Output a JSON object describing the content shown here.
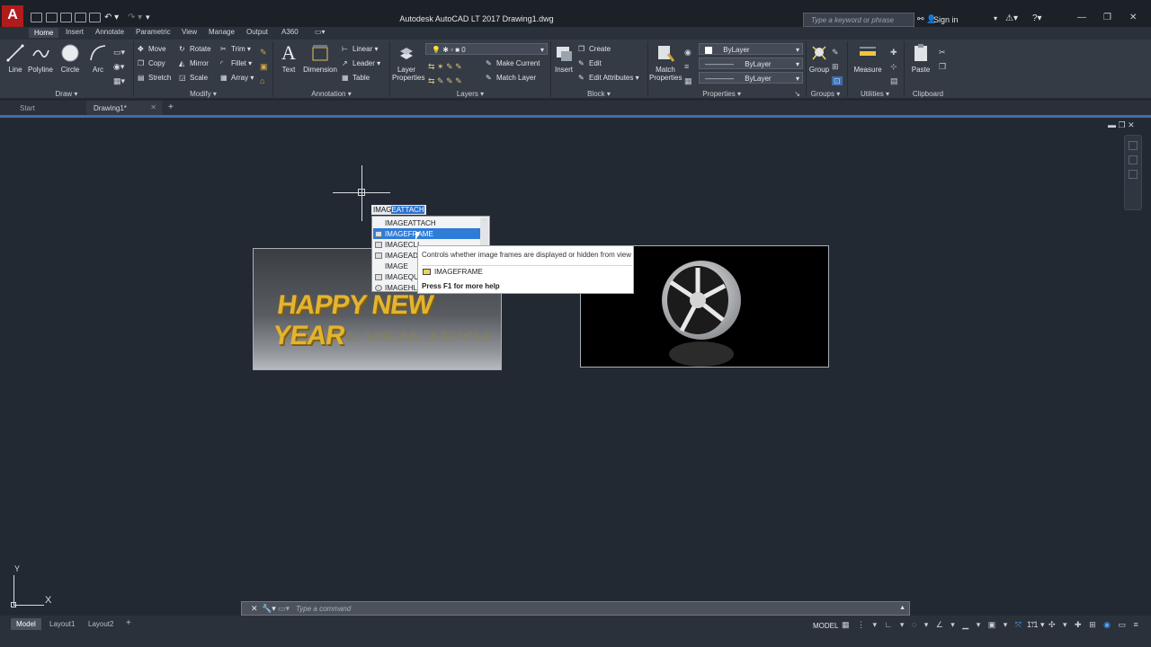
{
  "app": {
    "title": "Autodesk AutoCAD LT 2017   Drawing1.dwg",
    "logo_letter": "A",
    "search_placeholder": "Type a keyword or phrase",
    "signin": "Sign in"
  },
  "ribbon_tabs": [
    "Home",
    "Insert",
    "Annotate",
    "Parametric",
    "View",
    "Manage",
    "Output",
    "A360"
  ],
  "draw": {
    "line": "Line",
    "polyline": "Polyline",
    "circle": "Circle",
    "arc": "Arc",
    "panel": "Draw"
  },
  "modify": {
    "move": "Move",
    "rotate": "Rotate",
    "trim": "Trim",
    "copy": "Copy",
    "mirror": "Mirror",
    "fillet": "Fillet",
    "stretch": "Stretch",
    "scale": "Scale",
    "array": "Array",
    "panel": "Modify"
  },
  "annotation": {
    "text": "Text",
    "dimension": "Dimension",
    "linear": "Linear",
    "leader": "Leader",
    "table": "Table",
    "panel": "Annotation"
  },
  "layers": {
    "layer_properties": "Layer Properties",
    "current_layer": "0",
    "make_current": "Make Current",
    "match_layer": "Match Layer",
    "panel": "Layers"
  },
  "block": {
    "insert": "Insert",
    "create": "Create",
    "edit": "Edit",
    "edit_attributes": "Edit Attributes",
    "panel": "Block"
  },
  "properties": {
    "match_properties": "Match Properties",
    "color": "ByLayer",
    "linetype": "ByLayer",
    "lineweight": "ByLayer",
    "panel": "Properties"
  },
  "groups": {
    "group": "Group",
    "panel": "Groups"
  },
  "utilities": {
    "measure": "Measure",
    "panel": "Utilities"
  },
  "clipboard": {
    "paste": "Paste",
    "panel": "Clipboard"
  },
  "file_tabs": [
    "Start",
    "Drawing1*"
  ],
  "command": {
    "typed": "IMAG",
    "completion": "EATTACH",
    "suggestions": [
      "IMAGEATTACH",
      "IMAGEFRAME",
      "IMAGECLIP",
      "IMAGEADJUST",
      "IMAGE",
      "IMAGEQUALITY",
      "IMAGEHLT"
    ],
    "suggestions_display": [
      "IMAGEATTACH",
      "IMAGEFRAME",
      "IMAGECLI",
      "IMAGEAD",
      "IMAGE",
      "IMAGEQU",
      "IMAGEHL"
    ],
    "selected_index": 1,
    "tooltip_desc": "Controls whether image frames are displayed or hidden from view",
    "tooltip_cmd": "IMAGEFRAME",
    "tooltip_help": "Press F1 for more help",
    "placeholder": "Type  a  command"
  },
  "canvas": {
    "image1_text": "HAPPY NEW YEAR",
    "ucs_y": "Y",
    "ucs_x": "X"
  },
  "layout_tabs": [
    "Model",
    "Layout1",
    "Layout2"
  ],
  "status": {
    "model": "MODEL",
    "scale": "1:1"
  },
  "colors": {
    "accent": "#2e7bd8",
    "logo": "#b01b1b",
    "text_gold": "#e3b430"
  }
}
